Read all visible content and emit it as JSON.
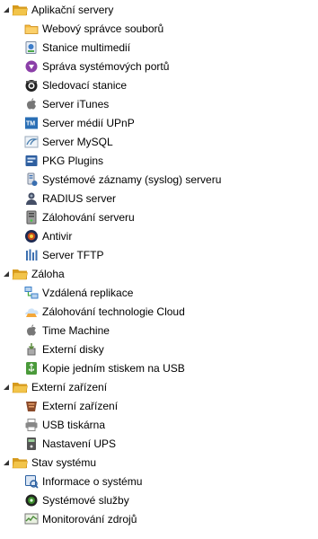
{
  "tree": {
    "categories": [
      {
        "label": "Aplikační servery",
        "items": [
          {
            "label": "Webový správce souborů",
            "icon": "folder-icon",
            "color": "#f6b83d"
          },
          {
            "label": "Stanice multimedií",
            "icon": "multimedia-station-icon",
            "color": "#3b7cc9"
          },
          {
            "label": "Správa systémových portů",
            "icon": "port-management-icon",
            "color": "#8b3fa8"
          },
          {
            "label": "Sledovací stanice",
            "icon": "surveillance-camera-icon",
            "color": "#333333"
          },
          {
            "label": "Server iTunes",
            "icon": "apple-icon",
            "color": "#777777"
          },
          {
            "label": "Server médií UPnP",
            "icon": "upnp-icon",
            "color": "#2a6fb5"
          },
          {
            "label": "Server MySQL",
            "icon": "mysql-icon",
            "color": "#4a7fb0"
          },
          {
            "label": "PKG Plugins",
            "icon": "plugins-icon",
            "color": "#2f5fa0"
          },
          {
            "label": "Systémové záznamy (syslog) serveru",
            "icon": "syslog-icon",
            "color": "#3a6fb0"
          },
          {
            "label": "RADIUS server",
            "icon": "radius-server-icon",
            "color": "#444e66"
          },
          {
            "label": "Zálohování serveru",
            "icon": "backup-server-icon",
            "color": "#555555"
          },
          {
            "label": "Antivir",
            "icon": "antivirus-icon",
            "color": "#c24a1e"
          },
          {
            "label": "Server TFTP",
            "icon": "tftp-icon",
            "color": "#3b6fb0"
          }
        ]
      },
      {
        "label": "Záloha",
        "items": [
          {
            "label": "Vzdálená replikace",
            "icon": "remote-replication-icon",
            "color": "#3a7fc8"
          },
          {
            "label": "Zálohování technologie Cloud",
            "icon": "cloud-backup-icon",
            "color": "#f3a73a"
          },
          {
            "label": "Time Machine",
            "icon": "apple-icon",
            "color": "#777777"
          },
          {
            "label": "Externí disky",
            "icon": "external-disk-icon",
            "color": "#5a8a3a"
          },
          {
            "label": "Kopie jedním stiskem na USB",
            "icon": "usb-copy-icon",
            "color": "#4a9a3a"
          }
        ]
      },
      {
        "label": "Externí zařízení",
        "items": [
          {
            "label": "Externí zařízení",
            "icon": "external-device-icon",
            "color": "#8a4a2a"
          },
          {
            "label": "USB tiskárna",
            "icon": "printer-icon",
            "color": "#888888"
          },
          {
            "label": "Nastavení UPS",
            "icon": "ups-icon",
            "color": "#555555"
          }
        ]
      },
      {
        "label": "Stav systému",
        "items": [
          {
            "label": "Informace o systému",
            "icon": "system-info-icon",
            "color": "#2a5fa0"
          },
          {
            "label": "Systémové služby",
            "icon": "system-services-icon",
            "color": "#3a8a2a"
          },
          {
            "label": "Monitorování zdrojů",
            "icon": "resource-monitor-icon",
            "color": "#4a8a3a"
          }
        ]
      }
    ]
  },
  "colors": {
    "folder": "#f2c44a",
    "folder_dark": "#d69a1c",
    "triangle": "#333333"
  }
}
